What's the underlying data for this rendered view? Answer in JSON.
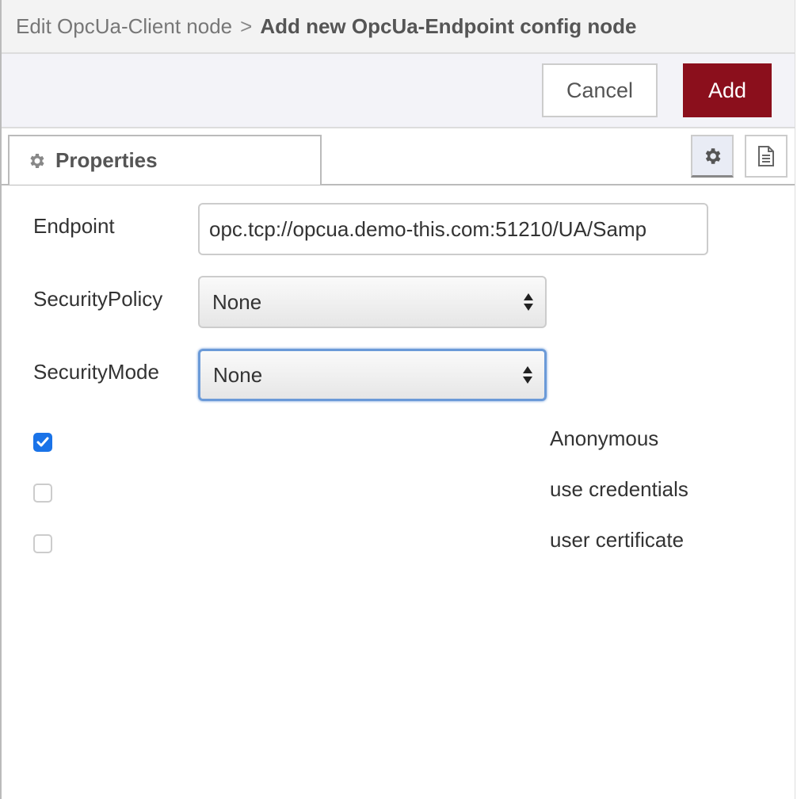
{
  "header": {
    "breadcrumb_parent": "Edit OpcUa-Client node",
    "separator": ">",
    "title": "Add new OpcUa-Endpoint config node"
  },
  "toolbar": {
    "cancel_label": "Cancel",
    "add_label": "Add"
  },
  "tabs": {
    "properties_label": "Properties"
  },
  "form": {
    "endpoint_label": "Endpoint",
    "endpoint_value": "opc.tcp://opcua.demo-this.com:51210/UA/Samp",
    "security_policy_label": "SecurityPolicy",
    "security_policy_value": "None",
    "security_mode_label": "SecurityMode",
    "security_mode_value": "None",
    "options": [
      {
        "label": "Anonymous",
        "checked": true
      },
      {
        "label": "use credentials",
        "checked": false
      },
      {
        "label": "user certificate",
        "checked": false
      }
    ]
  },
  "colors": {
    "accent_add": "#8b0f1c",
    "checkbox_checked": "#1a73e8",
    "focus_ring": "#6b9ad8"
  }
}
